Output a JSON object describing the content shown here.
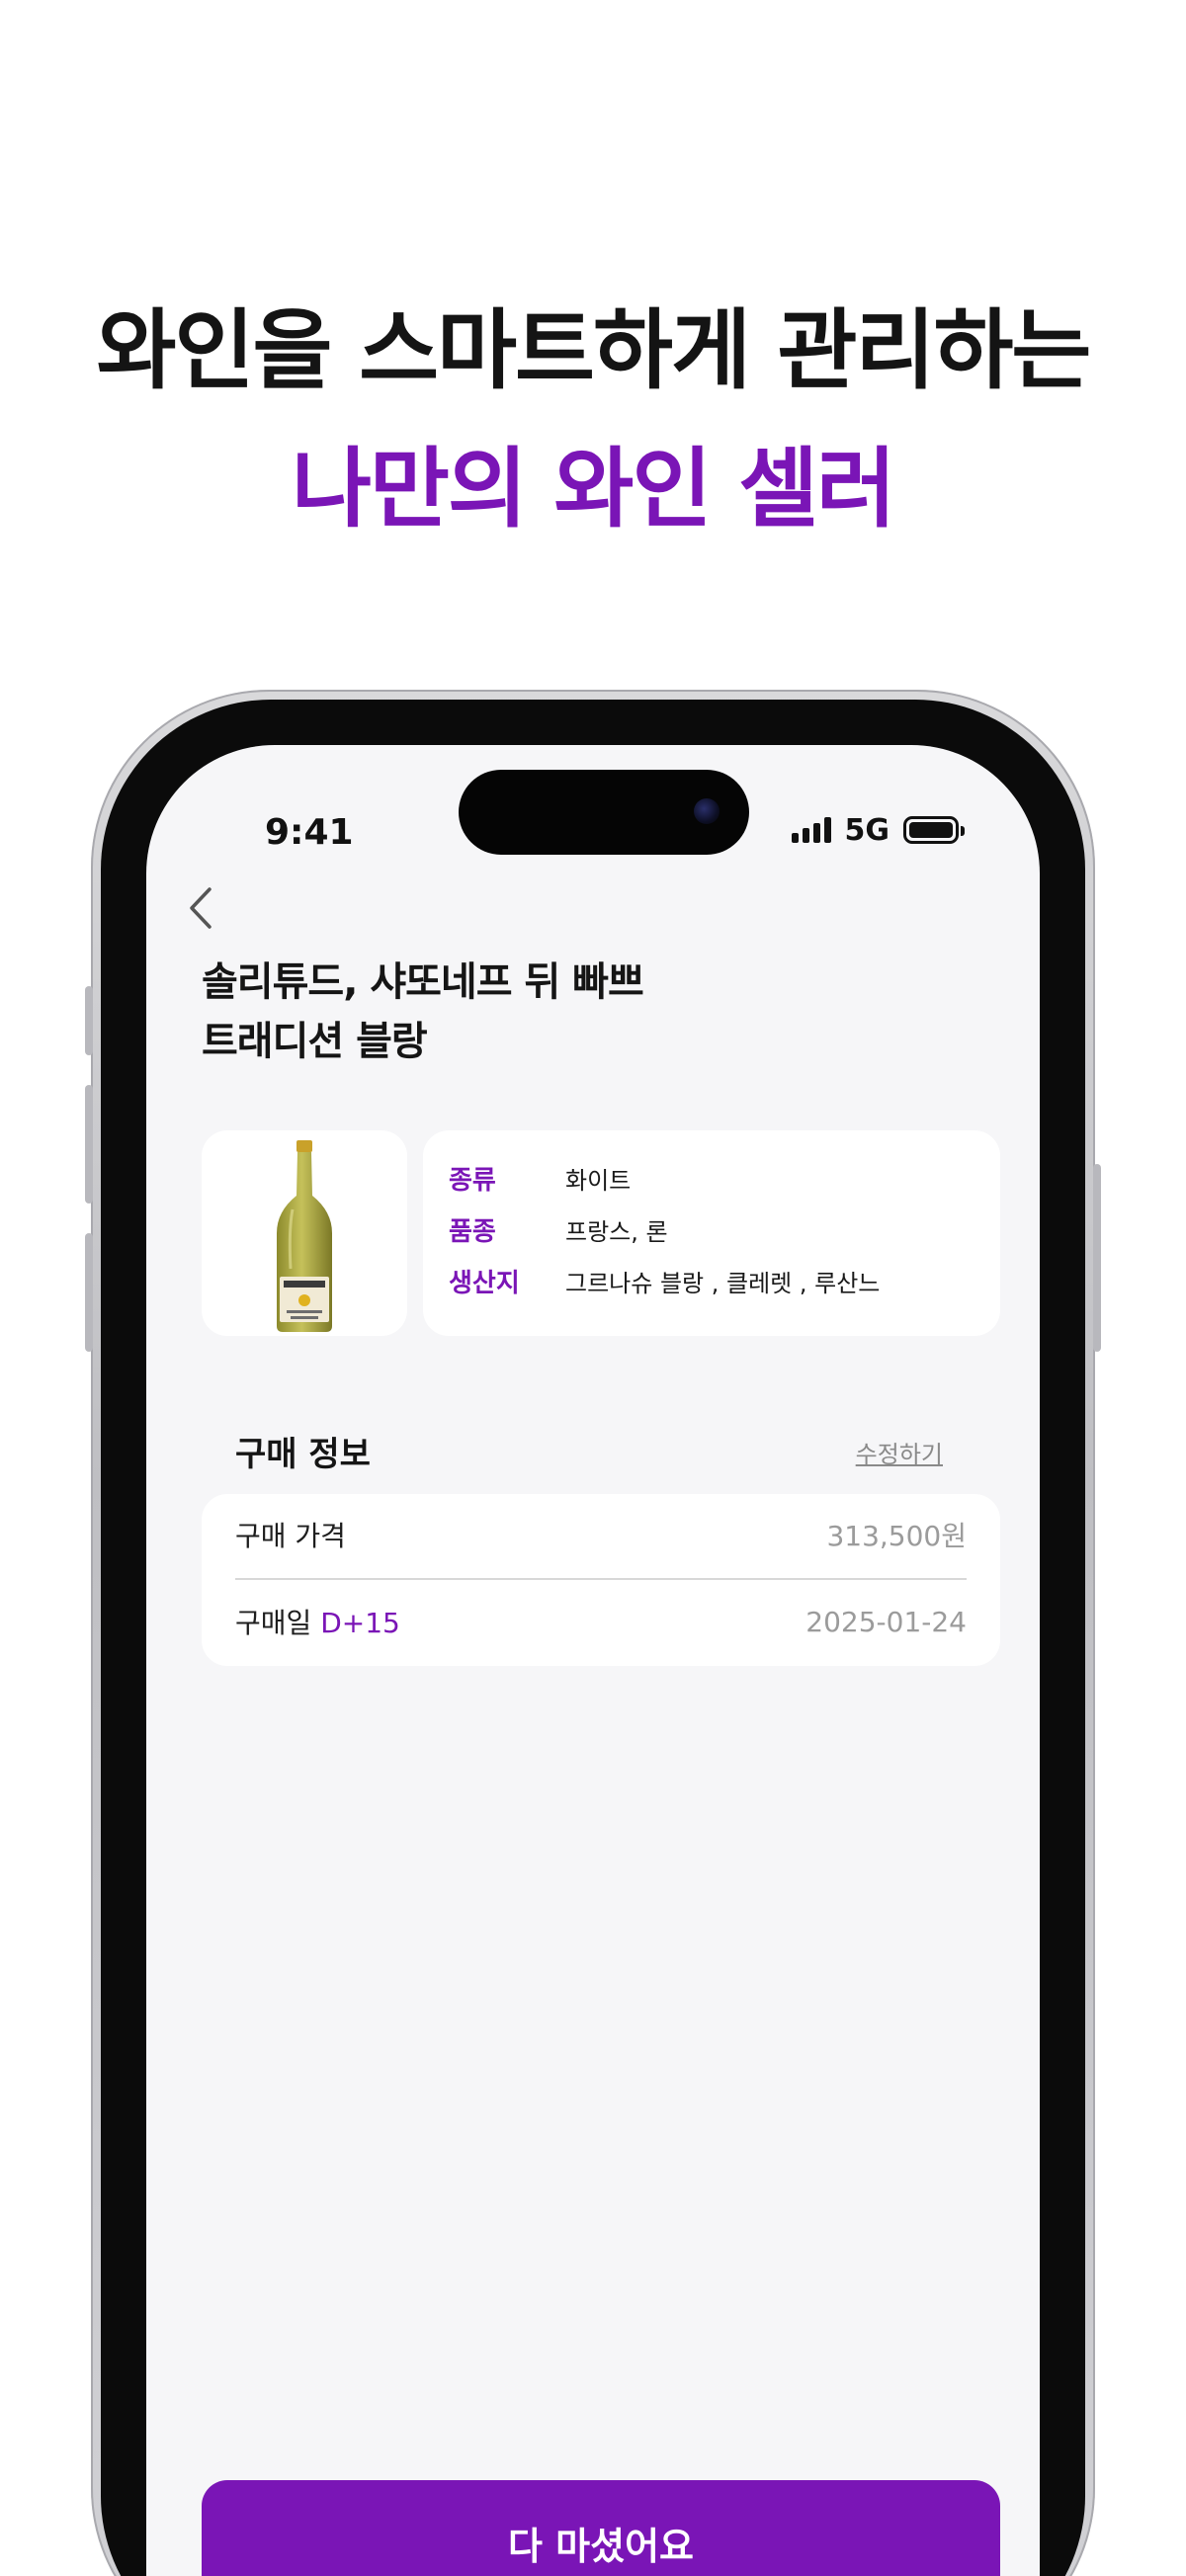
{
  "headline": {
    "line1": "와인을 스마트하게 관리하는",
    "line2": "나만의 와인 셀러"
  },
  "status_bar": {
    "time": "9:41",
    "network": "5G",
    "icons": [
      "signal-icon",
      "battery-icon"
    ]
  },
  "nav": {
    "back_icon": "chevron-left-icon"
  },
  "wine": {
    "title_line1": "솔리튜드, 샤또네프 뒤 빠쁘",
    "title_line2": "트래디션 블랑",
    "details": [
      {
        "key": "종류",
        "value": "화이트"
      },
      {
        "key": "품종",
        "value": "프랑스, 론"
      },
      {
        "key": "생산지",
        "value": "그르나슈 블랑 , 클레렛 , 루산느"
      }
    ]
  },
  "purchase": {
    "section_title": "구매 정보",
    "edit_label": "수정하기",
    "price_label": "구매 가격",
    "price_value": "313,500원",
    "date_label": "구매일",
    "date_dday": "D+15",
    "date_value": "2025-01-24"
  },
  "cta": {
    "label": "다 마셨어요"
  },
  "colors": {
    "accent": "#7a15b6",
    "screen_bg": "#f6f6f8",
    "card_bg": "#ffffff"
  }
}
